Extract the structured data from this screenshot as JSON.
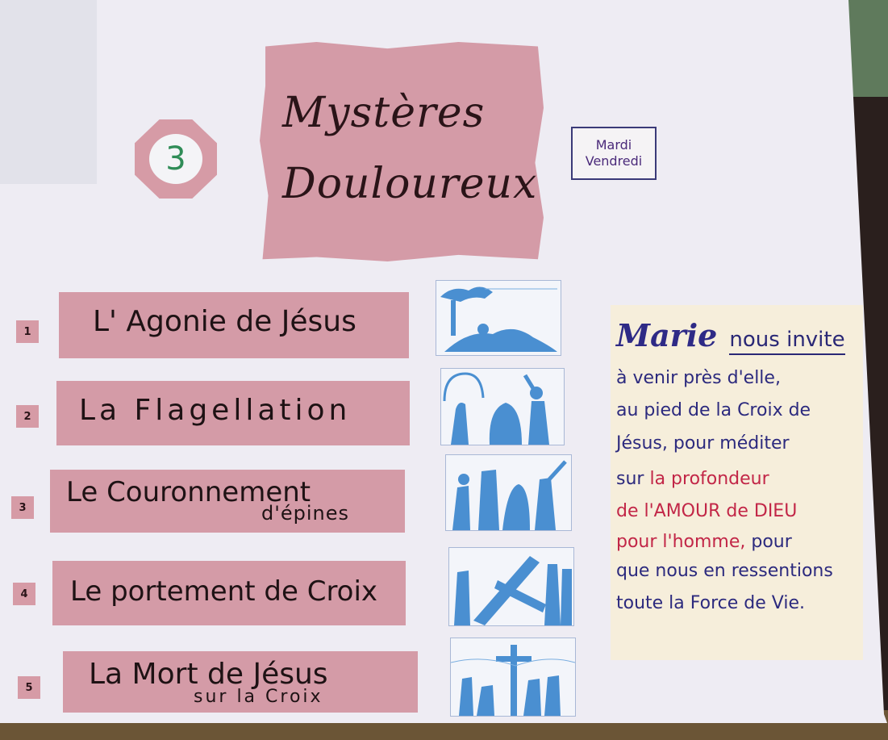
{
  "number": "3",
  "title": {
    "line1": "Mystères",
    "line2": "Douloureux"
  },
  "days": [
    "Mardi",
    "Vendredi"
  ],
  "mysteries": [
    {
      "num": "1",
      "title": "L' Agonie de Jésus",
      "sub": ""
    },
    {
      "num": "2",
      "title": "La Flagellation",
      "sub": ""
    },
    {
      "num": "3",
      "title": "Le Couronnement",
      "sub": "d'épines"
    },
    {
      "num": "4",
      "title": "Le portement de Croix",
      "sub": ""
    },
    {
      "num": "5",
      "title": "La Mort de Jésus",
      "sub": "sur la Croix"
    }
  ],
  "note": {
    "marie": "Marie",
    "invite": "nous invite",
    "lines": [
      {
        "text": "à venir près d'elle,",
        "color": "blue"
      },
      {
        "text": "au pied de la Croix de",
        "color": "blue"
      },
      {
        "text": "Jésus, pour méditer",
        "color": "blue"
      },
      {
        "text": "sur",
        "color": "blue",
        "rest": "la profondeur",
        "rest_color": "red"
      },
      {
        "text": "de l'AMOUR de DIEU",
        "color": "red"
      },
      {
        "text": "pour l'homme,",
        "color": "red",
        "rest": "pour",
        "rest_color": "blue"
      },
      {
        "text": "que nous en ressentions",
        "color": "blue"
      },
      {
        "text": "toute la Force de Vie.",
        "color": "blue"
      }
    ]
  },
  "colors": {
    "pink": "#d49ba7",
    "board": "#eeecf3",
    "note_bg": "#f6eedb",
    "ink_blue": "#2c2a7e",
    "ink_red": "#c22647",
    "picture_blue": "#4a8fd1"
  }
}
